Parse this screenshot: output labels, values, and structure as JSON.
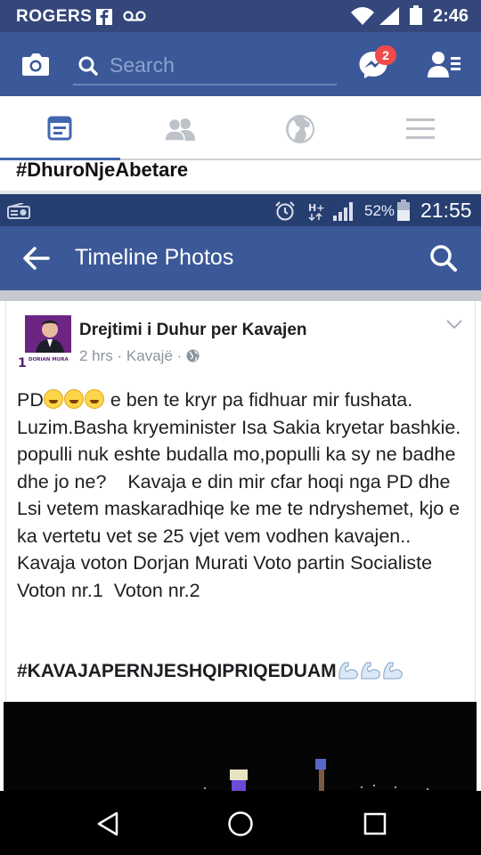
{
  "outer_status": {
    "carrier": "ROGERS",
    "time": "2:46"
  },
  "fb_header": {
    "search_placeholder": "Search",
    "messages_badge": "2"
  },
  "tabs": [
    "news-feed",
    "friends",
    "notifications",
    "menu"
  ],
  "caption": "#DhuroNjeAbetare",
  "inner_status": {
    "battery_pct": "52%",
    "time": "21:55"
  },
  "timeline": {
    "title": "Timeline Photos"
  },
  "post": {
    "page_name": "Drejtimi i Duhur per Kavajen",
    "time": "2 hrs",
    "location": "Kavajë",
    "text_prefix": "PD",
    "text_body": " e ben te kryr pa fidhuar mir fushata. Luzim.Basha kryeminister Isa Sakia kryetar bashkie.     populli nuk eshte budalla mo,populli ka sy ne badhe dhe jo ne?    Kavaja e din mir cfar hoqi nga PD dhe Lsi vetem maskaradhiqe ke me te ndryshemet, kjo e ka vertetu vet se 25 vjet vem vodhen kavajen..   Kavaja voton Dorjan Murati Voto partin Socialiste Voton nr.1  Voton nr.2",
    "hashtag": "#KAVAJAPERNJESHQIPRIQEDUAM",
    "avatar_text": "DORIAN MURA"
  },
  "colors": {
    "fb_blue": "#3b5998",
    "status_dark": "#263f70",
    "badge_red": "#f04a4a"
  }
}
